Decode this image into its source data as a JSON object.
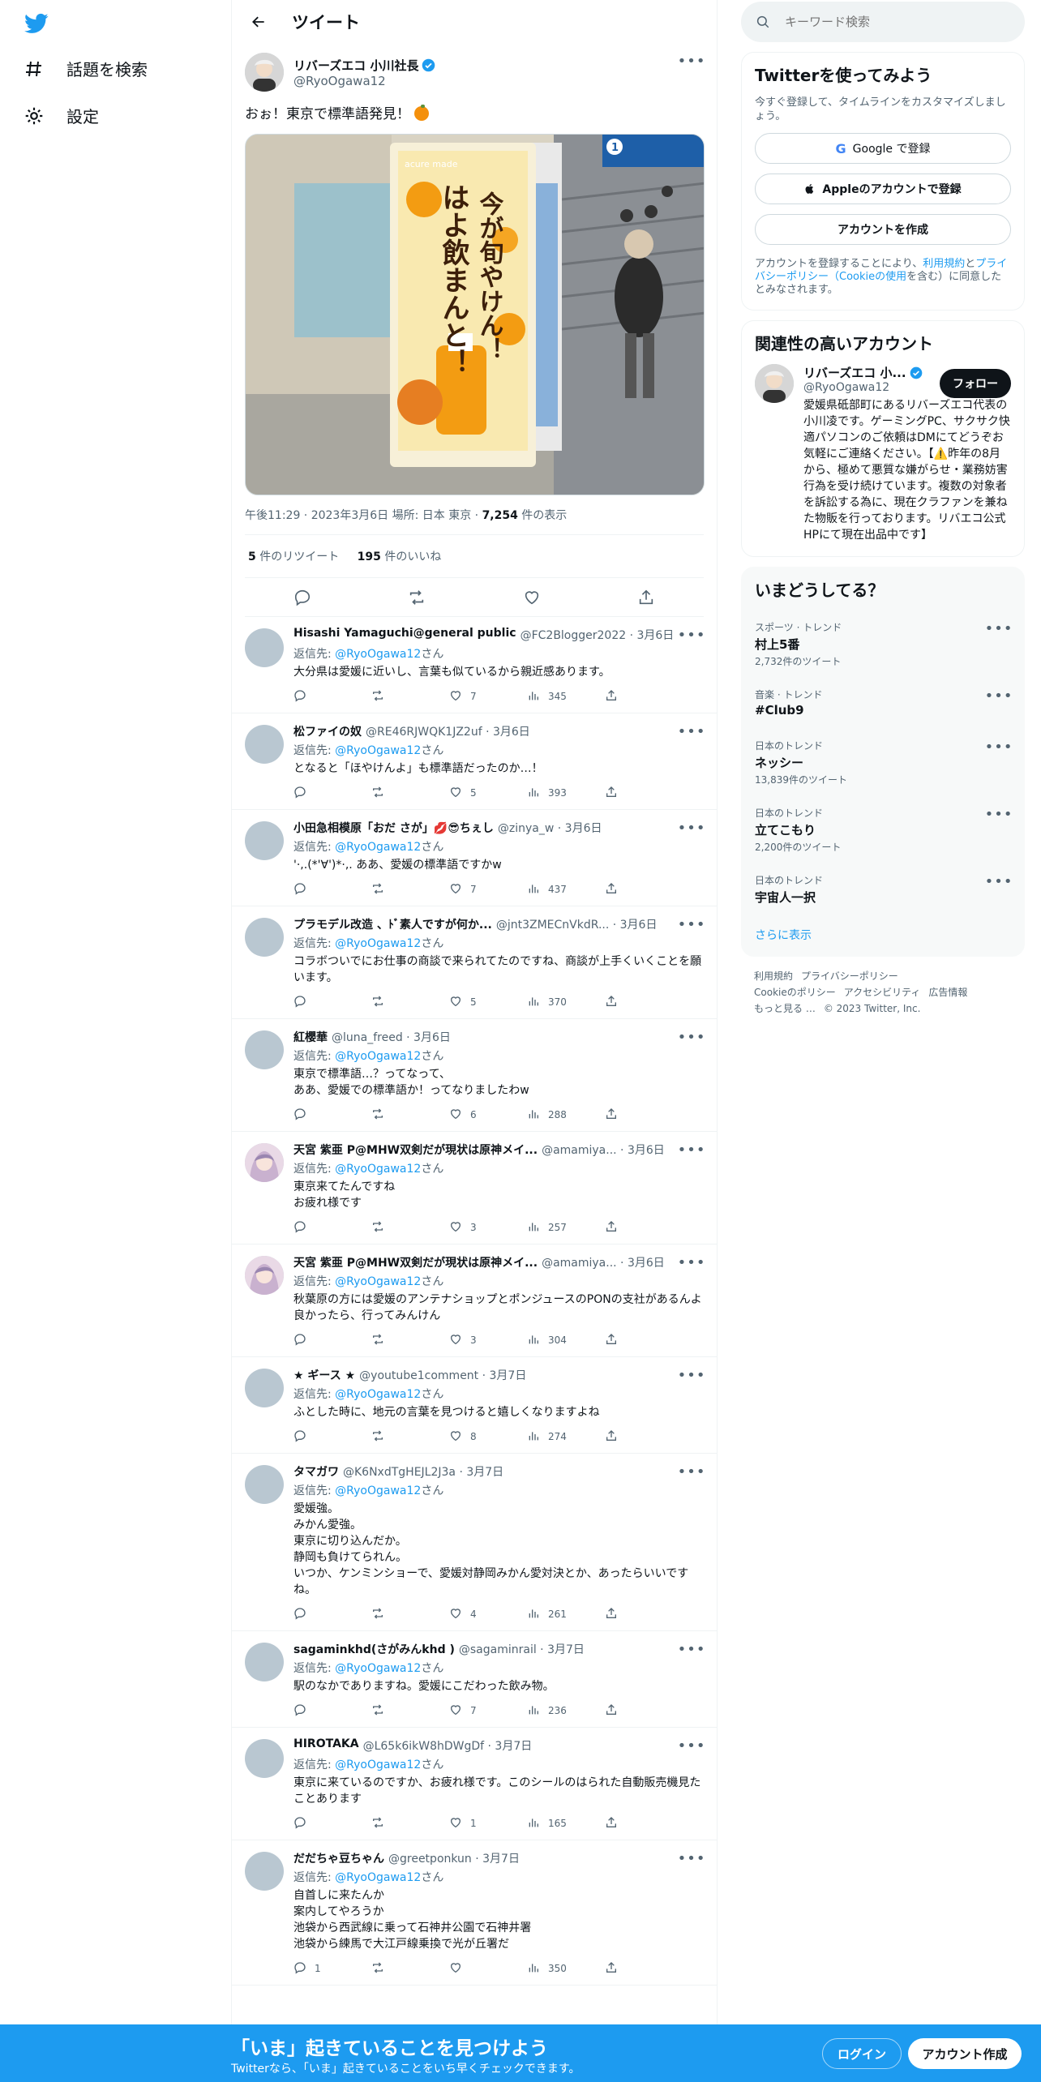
{
  "nav": {
    "explore_label": "話題を検索",
    "settings_label": "設定"
  },
  "header": {
    "title": "ツイート"
  },
  "tweet": {
    "display_name": "リバーズエコ 小川社長",
    "handle": "@RyoOgawa12",
    "text": "おぉ！東京で標準語発見！",
    "image": {
      "poster_line1": "今が旬やけん！",
      "poster_line2": "はよ飲まんと！",
      "brand": "acure made",
      "station_number": "1"
    },
    "meta_time": "午後11:29 · 2023年3月6日 場所: 日本 東京 · ",
    "meta_views_num": "7,254",
    "meta_views_label": " 件の表示",
    "retweets_num": "5",
    "retweets_label": " 件のリツイート",
    "likes_num": "195",
    "likes_label": " 件のいいね"
  },
  "reply_to_prefix": "返信先: ",
  "reply_to_mention": "@RyoOgawa12",
  "reply_to_suffix": "さん",
  "replies": [
    {
      "name": "Hisashi Yamaguchi@general public",
      "handle": "@FC2Blogger2022 · 3月6日",
      "text": "大分県は愛媛に近いし、言葉も似ているから親近感あります。",
      "replies": "",
      "retweets": "",
      "likes": "7",
      "views": "345"
    },
    {
      "name": "松ファイの奴",
      "handle": "@RE46RJWQK1JZ2uf · 3月6日",
      "text": "となると「ほやけんよ」も標準語だったのか…！",
      "replies": "",
      "retweets": "",
      "likes": "5",
      "views": "393"
    },
    {
      "name": "小田急相模原「おだ さが」💋😎ちぇし",
      "handle": "@zinya_w · 3月6日",
      "text": "'·,.(*'∀')*·,. ああ、愛媛の標準語ですかw",
      "replies": "",
      "retweets": "",
      "likes": "7",
      "views": "437"
    },
    {
      "name": "プラモデル改造 、ﾄﾞ素人ですが何か...",
      "handle": "@jnt3ZMECnVkdR... · 3月6日",
      "text": "コラボついでにお仕事の商談で来られてたのですね、商談が上手くいくことを願います。",
      "replies": "",
      "retweets": "",
      "likes": "5",
      "views": "370"
    },
    {
      "name": "紅櫻華",
      "handle": "@luna_freed · 3月6日",
      "text": "東京で標準語…？ってなって、\nああ、愛媛での標準語か！ってなりましたわw",
      "replies": "",
      "retweets": "",
      "likes": "6",
      "views": "288"
    },
    {
      "name": "天宮 紫亜 P@MHW双剣だが現状は原神メイ...",
      "handle": "@amamiya... · 3月6日",
      "text": "東京来てたんですね\nお疲れ様です",
      "replies": "",
      "retweets": "",
      "likes": "3",
      "views": "257"
    },
    {
      "name": "天宮 紫亜 P@MHW双剣だが現状は原神メイ...",
      "handle": "@amamiya... · 3月6日",
      "text": "秋葉原の方には愛媛のアンテナショップとポンジュースのPONの支社があるんよ\n良かったら、行ってみんけん",
      "replies": "",
      "retweets": "",
      "likes": "3",
      "views": "304"
    },
    {
      "name": "★ ギース ★",
      "handle": "@youtube1comment · 3月7日",
      "text": "ふとした時に、地元の言葉を見つけると嬉しくなりますよね",
      "replies": "",
      "retweets": "",
      "likes": "8",
      "views": "274"
    },
    {
      "name": "タマガワ",
      "handle": "@K6NxdTgHEJL2J3a · 3月7日",
      "text": "愛媛強。\nみかん愛強。\n東京に切り込んだか。\n静岡も負けてられん。\nいつか、ケンミンショーで、愛媛対静岡みかん愛対決とか、あったらいいですね。",
      "replies": "",
      "retweets": "",
      "likes": "4",
      "views": "261"
    },
    {
      "name": "sagaminkhd(さがみんkhd )",
      "handle": "@sagaminrail · 3月7日",
      "text": "駅のなかでありますね。愛媛にこだわった飲み物。",
      "replies": "",
      "retweets": "",
      "likes": "7",
      "views": "236"
    },
    {
      "name": "HIROTAKA",
      "handle": "@L65k6ikW8hDWgDf · 3月7日",
      "text": "東京に来ているのですか、お疲れ様です。このシールのはられた自動販売機見たことあります",
      "replies": "",
      "retweets": "",
      "likes": "1",
      "views": "165"
    },
    {
      "name": "だだちゃ豆ちゃん",
      "handle": "@greetponkun · 3月7日",
      "text": "自首しに来たんか\n案内してやろうか\n池袋から西武線に乗って石神井公園で石神井署\n池袋から練馬で大江戸線乗換で光が丘署だ",
      "replies": "1",
      "retweets": "",
      "likes": "",
      "views": "350"
    }
  ],
  "search": {
    "placeholder": "キーワード検索"
  },
  "signup_card": {
    "title": "Twitterを使ってみよう",
    "subtitle": "今すぐ登録して、タイムラインをカスタマイズしましょう。",
    "google_btn": "Google で登録",
    "apple_btn": "Appleのアカウントで登録",
    "create_btn": "アカウントを作成",
    "terms_a": "アカウントを登録することにより、",
    "terms_link1": "利用規約",
    "terms_b": "と",
    "terms_link2": "プライバシーポリシー（Cookieの使用",
    "terms_c": "を含む）に同意したとみなされます。"
  },
  "relevant": {
    "title": "関連性の高いアカウント",
    "name": "リバーズエコ 小...",
    "handle": "@RyoOgawa12",
    "follow": "フォロー",
    "bio": "愛媛県砥部町にあるリバーズエコ代表の小川凌です。ゲーミングPC、サクサク快適パソコンのご依頼はDMにてどうぞお気軽にご連絡ください。【⚠️昨年の8月から、極めて悪質な嫌がらせ・業務妨害行為を受け続けています。複数の対象者を訴訟する為に、現在クラファンを兼ねた物販を行っております。リバエコ公式HPにて現在出品中です】"
  },
  "trends": {
    "title": "いまどうしてる？",
    "items": [
      {
        "context": "スポーツ · トレンド",
        "name": "村上5番",
        "count": "2,732件のツイート"
      },
      {
        "context": "音楽 · トレンド",
        "name": "#Club9",
        "count": ""
      },
      {
        "context": "日本のトレンド",
        "name": "ネッシー",
        "count": "13,839件のツイート"
      },
      {
        "context": "日本のトレンド",
        "name": "立てこもり",
        "count": "2,200件のツイート"
      },
      {
        "context": "日本のトレンド",
        "name": "宇宙人一択",
        "count": ""
      }
    ],
    "show_more": "さらに表示"
  },
  "footer": {
    "terms": "利用規約",
    "privacy": "プライバシーポリシー",
    "cookie": "Cookieのポリシー",
    "accessibility": "アクセシビリティ",
    "ads": "広告情報",
    "more": "もっと見る …",
    "copyright": "© 2023 Twitter, Inc."
  },
  "bottom_bar": {
    "title": "「いま」起きていることを見つけよう",
    "subtitle": "Twitterなら、「いま」起きていることをいち早くチェックできます。",
    "login": "ログイン",
    "signup": "アカウント作成"
  },
  "colors": {
    "accent": "#1d9bf0",
    "text": "#0f1419",
    "muted": "#536471"
  }
}
